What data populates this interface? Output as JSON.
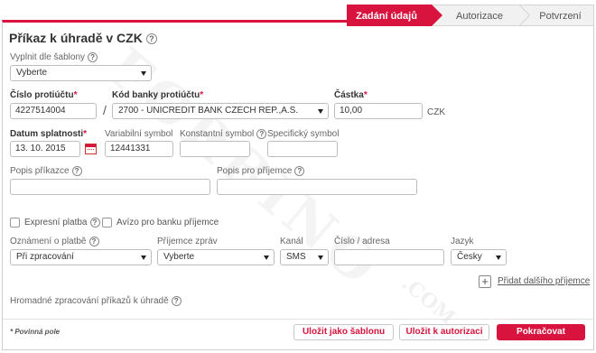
{
  "steps": [
    {
      "label": "Zadání údajů",
      "active": true
    },
    {
      "label": "Autorizace",
      "active": false
    },
    {
      "label": "Potvrzení",
      "active": false
    }
  ],
  "title": "Příkaz k úhradě v CZK",
  "template": {
    "label": "Vyplnit dle šablony",
    "value": "Vyberte"
  },
  "account": {
    "label": "Číslo protiúčtu",
    "value": "4227514004",
    "separator": "/"
  },
  "bank": {
    "label": "Kód banky protiúčtu",
    "value": "2700 - UNICREDIT BANK CZECH REP.,A.S."
  },
  "amount": {
    "label": "Částka",
    "value": "10,00",
    "currency": "CZK"
  },
  "due_date": {
    "label": "Datum splatnosti",
    "value": "13. 10. 2015"
  },
  "var_symbol": {
    "label": "Variabilní symbol",
    "value": "12441331"
  },
  "const_symbol": {
    "label": "Konstantní symbol",
    "value": ""
  },
  "spec_symbol": {
    "label": "Specifický symbol",
    "value": ""
  },
  "order_desc": {
    "label": "Popis příkazce",
    "value": ""
  },
  "recipient_desc": {
    "label": "Popis pro příjemce",
    "value": ""
  },
  "express": {
    "label": "Expresní platba",
    "checked": false
  },
  "notice": {
    "label": "Avízo pro banku příjemce",
    "checked": false
  },
  "notification": {
    "label": "Oznámení o platbě",
    "value": "Při zpracování"
  },
  "msg_recipient": {
    "label": "Příjemce zpráv",
    "value": "Vyberte"
  },
  "channel": {
    "label": "Kanál",
    "value": "SMS"
  },
  "address": {
    "label": "Číslo / adresa",
    "value": ""
  },
  "language": {
    "label": "Jazyk",
    "value": "Česky"
  },
  "add_recipient": "Přidat dalšího příjemce",
  "bulk": "Hromadné zpracování příkazů k úhradě",
  "required_note": "* Povinná pole",
  "required_mark": "*",
  "buttons": {
    "save_template": "Uložit jako šablonu",
    "save_auth": "Uložit k autorizaci",
    "continue": "Pokračovat"
  },
  "watermark": "FORBINO",
  "watermark2": ".COM",
  "colors": {
    "accent": "#d8133e"
  }
}
